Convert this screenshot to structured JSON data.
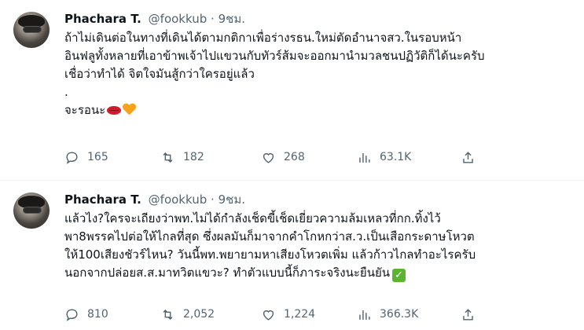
{
  "tweets": [
    {
      "author": {
        "name": "Phachara T.",
        "handle": "@fookkub",
        "separator": "·",
        "time": "9ชม."
      },
      "lines": [
        "ถ้าไม่เดินต่อในทางที่เดินได้ตามกติกาเพื่อร่างรธน.ใหม่ตัดอำนาจสว.ในรอบหน้า",
        "อินฟลูทั้งหลายที่เอาข้าพเจ้าไปแขวนกับทัวร์ส้มจะออกมานำมวลชนปฏิวัติก็ได้นะครับ",
        "เชื่อว่าทำได้ จิตใจมันสู้กว่าใครอยู่แล้ว",
        ".",
        "จะรอนะ"
      ],
      "emoji": [
        "lips-icon",
        "orange-heart-icon"
      ],
      "stats": {
        "replies": "165",
        "retweets": "182",
        "likes": "268",
        "views": "63.1K"
      }
    },
    {
      "author": {
        "name": "Phachara T.",
        "handle": "@fookkub",
        "separator": "·",
        "time": "9ชม."
      },
      "lines": [
        "แล้วไง?ใครจะเถียงว่าพท.ไม่ได้กำลังเช็ดขี้เช็ดเยี่ยวความล้มเหลวที่กก.ทิ้งไว้",
        "พา8พรรคไปต่อให้ไกลที่สุด ซึ่งผลมันก็มาจากคำโกหกว่าส.ว.เป็นเสือกระดาษโหวต",
        "ให้100เสียงชัวร์ไหน? วันนี้พท.พยายามหาเสียงโหวตเพิ่ม แล้วก้าวไกลทำอะไรครับ",
        "นอกจากปล่อยส.ส.มาทวิตแขวะ? ทำตัวแบบนี้ก็ภาระจริงนะยืนยัน"
      ],
      "emoji": [
        "check-mark-icon"
      ],
      "stats": {
        "replies": "810",
        "retweets": "2,052",
        "likes": "1,224",
        "views": "366.3K"
      }
    }
  ],
  "colors": {
    "text": "#0f1419",
    "secondary": "#536471",
    "divider": "#eff3f4"
  }
}
